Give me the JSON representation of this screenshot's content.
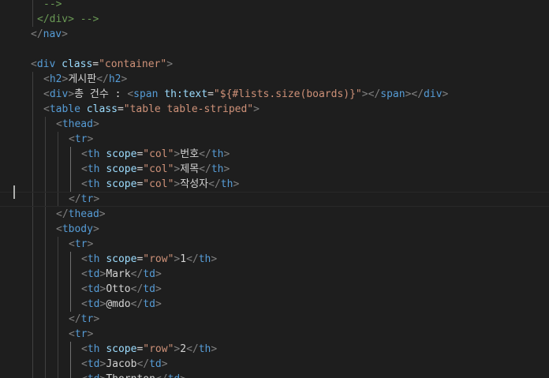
{
  "editor": {
    "lines": [
      {
        "indent": 5,
        "parts": [
          {
            "t": "-->",
            "c": "cmt"
          }
        ]
      },
      {
        "indent": 4,
        "parts": [
          {
            "t": "</div> -->",
            "c": "cmt"
          }
        ]
      },
      {
        "indent": 3,
        "parts": [
          {
            "t": "</",
            "c": "bracket"
          },
          {
            "t": "nav",
            "c": "tag"
          },
          {
            "t": ">",
            "c": "bracket"
          }
        ]
      },
      {
        "indent": 3,
        "parts": []
      },
      {
        "indent": 3,
        "parts": [
          {
            "t": "<",
            "c": "bracket"
          },
          {
            "t": "div",
            "c": "tag"
          },
          {
            "t": " ",
            "c": "txt"
          },
          {
            "t": "class",
            "c": "attr"
          },
          {
            "t": "=",
            "c": "txt"
          },
          {
            "t": "\"container\"",
            "c": "str"
          },
          {
            "t": ">",
            "c": "bracket"
          }
        ]
      },
      {
        "indent": 5,
        "parts": [
          {
            "t": "<",
            "c": "bracket"
          },
          {
            "t": "h2",
            "c": "tag"
          },
          {
            "t": ">",
            "c": "bracket"
          },
          {
            "t": "게시판",
            "c": "txt"
          },
          {
            "t": "</",
            "c": "bracket"
          },
          {
            "t": "h2",
            "c": "tag"
          },
          {
            "t": ">",
            "c": "bracket"
          }
        ]
      },
      {
        "indent": 5,
        "parts": [
          {
            "t": "<",
            "c": "bracket"
          },
          {
            "t": "div",
            "c": "tag"
          },
          {
            "t": ">",
            "c": "bracket"
          },
          {
            "t": "총 건수 : ",
            "c": "txt"
          },
          {
            "t": "<",
            "c": "bracket"
          },
          {
            "t": "span",
            "c": "tag"
          },
          {
            "t": " ",
            "c": "txt"
          },
          {
            "t": "th:text",
            "c": "attr"
          },
          {
            "t": "=",
            "c": "txt"
          },
          {
            "t": "\"${#lists.size(boards)}\"",
            "c": "str"
          },
          {
            "t": ">",
            "c": "bracket"
          },
          {
            "t": "</",
            "c": "bracket"
          },
          {
            "t": "span",
            "c": "tag"
          },
          {
            "t": ">",
            "c": "bracket"
          },
          {
            "t": "</",
            "c": "bracket"
          },
          {
            "t": "div",
            "c": "tag"
          },
          {
            "t": ">",
            "c": "bracket"
          }
        ]
      },
      {
        "indent": 5,
        "parts": [
          {
            "t": "<",
            "c": "bracket"
          },
          {
            "t": "table",
            "c": "tag"
          },
          {
            "t": " ",
            "c": "txt"
          },
          {
            "t": "class",
            "c": "attr"
          },
          {
            "t": "=",
            "c": "txt"
          },
          {
            "t": "\"table table-striped\"",
            "c": "str"
          },
          {
            "t": ">",
            "c": "bracket"
          }
        ]
      },
      {
        "indent": 7,
        "parts": [
          {
            "t": "<",
            "c": "bracket"
          },
          {
            "t": "thead",
            "c": "tag"
          },
          {
            "t": ">",
            "c": "bracket"
          }
        ]
      },
      {
        "indent": 9,
        "parts": [
          {
            "t": "<",
            "c": "bracket"
          },
          {
            "t": "tr",
            "c": "tag"
          },
          {
            "t": ">",
            "c": "bracket"
          }
        ]
      },
      {
        "indent": 11,
        "parts": [
          {
            "t": "<",
            "c": "bracket"
          },
          {
            "t": "th",
            "c": "tag"
          },
          {
            "t": " ",
            "c": "txt"
          },
          {
            "t": "scope",
            "c": "attr"
          },
          {
            "t": "=",
            "c": "txt"
          },
          {
            "t": "\"col\"",
            "c": "str"
          },
          {
            "t": ">",
            "c": "bracket"
          },
          {
            "t": "번호",
            "c": "txt"
          },
          {
            "t": "</",
            "c": "bracket"
          },
          {
            "t": "th",
            "c": "tag"
          },
          {
            "t": ">",
            "c": "bracket"
          }
        ]
      },
      {
        "indent": 11,
        "parts": [
          {
            "t": "<",
            "c": "bracket"
          },
          {
            "t": "th",
            "c": "tag"
          },
          {
            "t": " ",
            "c": "txt"
          },
          {
            "t": "scope",
            "c": "attr"
          },
          {
            "t": "=",
            "c": "txt"
          },
          {
            "t": "\"col\"",
            "c": "str"
          },
          {
            "t": ">",
            "c": "bracket"
          },
          {
            "t": "제목",
            "c": "txt"
          },
          {
            "t": "</",
            "c": "bracket"
          },
          {
            "t": "th",
            "c": "tag"
          },
          {
            "t": ">",
            "c": "bracket"
          }
        ]
      },
      {
        "indent": 11,
        "parts": [
          {
            "t": "<",
            "c": "bracket"
          },
          {
            "t": "th",
            "c": "tag"
          },
          {
            "t": " ",
            "c": "txt"
          },
          {
            "t": "scope",
            "c": "attr"
          },
          {
            "t": "=",
            "c": "txt"
          },
          {
            "t": "\"col\"",
            "c": "str"
          },
          {
            "t": ">",
            "c": "bracket"
          },
          {
            "t": "작성자",
            "c": "txt"
          },
          {
            "t": "</",
            "c": "bracket"
          },
          {
            "t": "th",
            "c": "tag"
          },
          {
            "t": ">",
            "c": "bracket"
          }
        ]
      },
      {
        "indent": 9,
        "parts": [
          {
            "t": "</",
            "c": "bracket"
          },
          {
            "t": "tr",
            "c": "tag"
          },
          {
            "t": ">",
            "c": "bracket"
          }
        ]
      },
      {
        "indent": 7,
        "parts": [
          {
            "t": "</",
            "c": "bracket"
          },
          {
            "t": "thead",
            "c": "tag"
          },
          {
            "t": ">",
            "c": "bracket"
          }
        ]
      },
      {
        "indent": 7,
        "parts": [
          {
            "t": "<",
            "c": "bracket"
          },
          {
            "t": "tbody",
            "c": "tag"
          },
          {
            "t": ">",
            "c": "bracket"
          }
        ]
      },
      {
        "indent": 9,
        "parts": [
          {
            "t": "<",
            "c": "bracket"
          },
          {
            "t": "tr",
            "c": "tag"
          },
          {
            "t": ">",
            "c": "bracket"
          }
        ]
      },
      {
        "indent": 11,
        "parts": [
          {
            "t": "<",
            "c": "bracket"
          },
          {
            "t": "th",
            "c": "tag"
          },
          {
            "t": " ",
            "c": "txt"
          },
          {
            "t": "scope",
            "c": "attr"
          },
          {
            "t": "=",
            "c": "txt"
          },
          {
            "t": "\"row\"",
            "c": "str"
          },
          {
            "t": ">",
            "c": "bracket"
          },
          {
            "t": "1",
            "c": "txt"
          },
          {
            "t": "</",
            "c": "bracket"
          },
          {
            "t": "th",
            "c": "tag"
          },
          {
            "t": ">",
            "c": "bracket"
          }
        ]
      },
      {
        "indent": 11,
        "parts": [
          {
            "t": "<",
            "c": "bracket"
          },
          {
            "t": "td",
            "c": "tag"
          },
          {
            "t": ">",
            "c": "bracket"
          },
          {
            "t": "Mark",
            "c": "txt"
          },
          {
            "t": "</",
            "c": "bracket"
          },
          {
            "t": "td",
            "c": "tag"
          },
          {
            "t": ">",
            "c": "bracket"
          }
        ]
      },
      {
        "indent": 11,
        "parts": [
          {
            "t": "<",
            "c": "bracket"
          },
          {
            "t": "td",
            "c": "tag"
          },
          {
            "t": ">",
            "c": "bracket"
          },
          {
            "t": "Otto",
            "c": "txt"
          },
          {
            "t": "</",
            "c": "bracket"
          },
          {
            "t": "td",
            "c": "tag"
          },
          {
            "t": ">",
            "c": "bracket"
          }
        ]
      },
      {
        "indent": 11,
        "parts": [
          {
            "t": "<",
            "c": "bracket"
          },
          {
            "t": "td",
            "c": "tag"
          },
          {
            "t": ">",
            "c": "bracket"
          },
          {
            "t": "@mdo",
            "c": "txt"
          },
          {
            "t": "</",
            "c": "bracket"
          },
          {
            "t": "td",
            "c": "tag"
          },
          {
            "t": ">",
            "c": "bracket"
          }
        ]
      },
      {
        "indent": 9,
        "parts": [
          {
            "t": "</",
            "c": "bracket"
          },
          {
            "t": "tr",
            "c": "tag"
          },
          {
            "t": ">",
            "c": "bracket"
          }
        ]
      },
      {
        "indent": 9,
        "parts": [
          {
            "t": "<",
            "c": "bracket"
          },
          {
            "t": "tr",
            "c": "tag"
          },
          {
            "t": ">",
            "c": "bracket"
          }
        ]
      },
      {
        "indent": 11,
        "parts": [
          {
            "t": "<",
            "c": "bracket"
          },
          {
            "t": "th",
            "c": "tag"
          },
          {
            "t": " ",
            "c": "txt"
          },
          {
            "t": "scope",
            "c": "attr"
          },
          {
            "t": "=",
            "c": "txt"
          },
          {
            "t": "\"row\"",
            "c": "str"
          },
          {
            "t": ">",
            "c": "bracket"
          },
          {
            "t": "2",
            "c": "txt"
          },
          {
            "t": "</",
            "c": "bracket"
          },
          {
            "t": "th",
            "c": "tag"
          },
          {
            "t": ">",
            "c": "bracket"
          }
        ]
      },
      {
        "indent": 11,
        "parts": [
          {
            "t": "<",
            "c": "bracket"
          },
          {
            "t": "td",
            "c": "tag"
          },
          {
            "t": ">",
            "c": "bracket"
          },
          {
            "t": "Jacob",
            "c": "txt"
          },
          {
            "t": "</",
            "c": "bracket"
          },
          {
            "t": "td",
            "c": "tag"
          },
          {
            "t": ">",
            "c": "bracket"
          }
        ]
      },
      {
        "indent": 11,
        "parts": [
          {
            "t": "<",
            "c": "bracket"
          },
          {
            "t": "td",
            "c": "tag"
          },
          {
            "t": ">",
            "c": "bracket"
          },
          {
            "t": "Thornton",
            "c": "txt"
          },
          {
            "t": "</",
            "c": "bracket"
          },
          {
            "t": "td",
            "c": "tag"
          },
          {
            "t": ">",
            "c": "bracket"
          }
        ]
      }
    ],
    "current_line": 13
  },
  "colors": {
    "background": "#1e1e1e",
    "tag": "#569cd6",
    "bracket": "#808080",
    "attribute": "#9cdcfe",
    "string": "#ce9178",
    "text": "#d4d4d4",
    "comment": "#6a9955",
    "indent_guide": "#404040",
    "cursor": "#aeafad"
  }
}
